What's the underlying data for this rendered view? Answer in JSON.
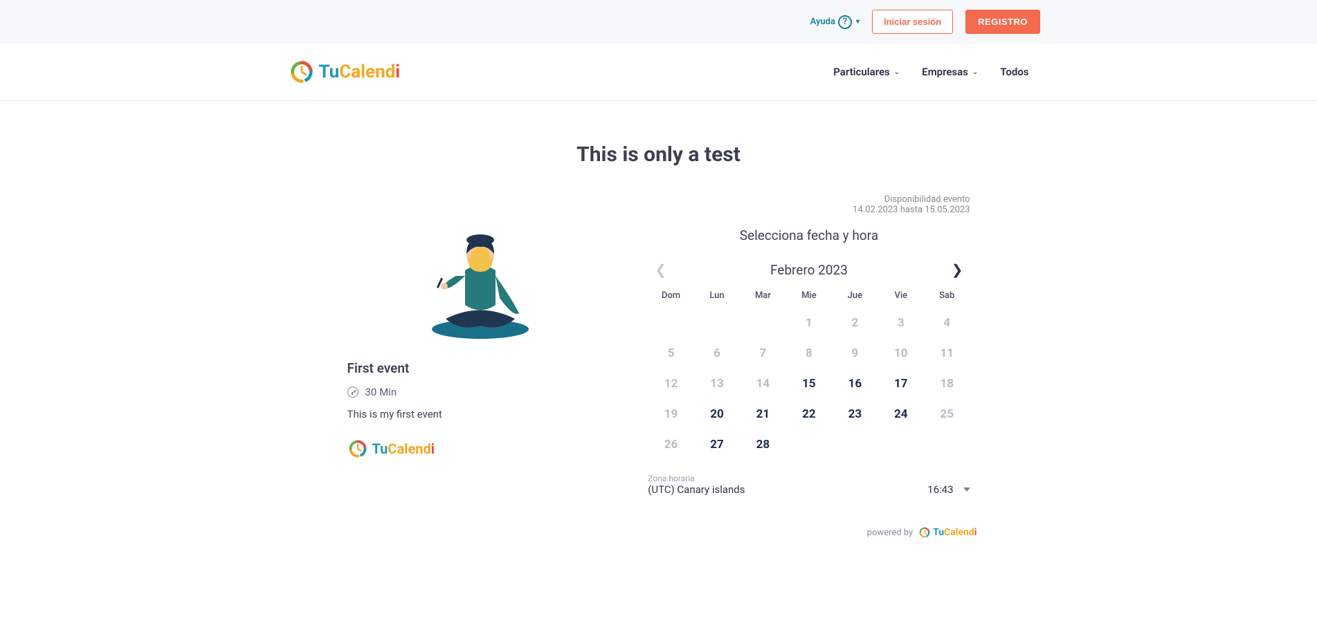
{
  "brand": {
    "name_part1": "Tu",
    "name_part2": "Calend",
    "name_part3": "i"
  },
  "utility": {
    "help_label": "Ayuda",
    "login_label": "Iniciar sesión",
    "register_label": "REGISTRO"
  },
  "nav": {
    "items": [
      {
        "label": "Particulares",
        "has_submenu": true
      },
      {
        "label": "Empresas",
        "has_submenu": true
      },
      {
        "label": "Todos",
        "has_submenu": false
      }
    ]
  },
  "page": {
    "title": "This is only a test"
  },
  "event": {
    "title": "First event",
    "duration": "30 Min",
    "description": "This is my first event"
  },
  "booking": {
    "availability_label": "Disponibilidad evento",
    "availability_range": "14.02.2023 hasta 15.05.2023",
    "heading": "Selecciona fecha y hora"
  },
  "calendar": {
    "month_label": "Febrero 2023",
    "prev_enabled": false,
    "next_enabled": true,
    "weekdays": [
      "Dom",
      "Lun",
      "Mar",
      "Mie",
      "Jue",
      "Vie",
      "Sab"
    ],
    "leading_blanks": 3,
    "days": [
      {
        "n": 1,
        "state": "disabled"
      },
      {
        "n": 2,
        "state": "disabled"
      },
      {
        "n": 3,
        "state": "disabled"
      },
      {
        "n": 4,
        "state": "disabled"
      },
      {
        "n": 5,
        "state": "disabled"
      },
      {
        "n": 6,
        "state": "disabled"
      },
      {
        "n": 7,
        "state": "disabled"
      },
      {
        "n": 8,
        "state": "disabled"
      },
      {
        "n": 9,
        "state": "disabled"
      },
      {
        "n": 10,
        "state": "disabled"
      },
      {
        "n": 11,
        "state": "disabled"
      },
      {
        "n": 12,
        "state": "disabled"
      },
      {
        "n": 13,
        "state": "disabled"
      },
      {
        "n": 14,
        "state": "disabled"
      },
      {
        "n": 15,
        "state": "available"
      },
      {
        "n": 16,
        "state": "available"
      },
      {
        "n": 17,
        "state": "available"
      },
      {
        "n": 18,
        "state": "disabled"
      },
      {
        "n": 19,
        "state": "disabled"
      },
      {
        "n": 20,
        "state": "available"
      },
      {
        "n": 21,
        "state": "available"
      },
      {
        "n": 22,
        "state": "available"
      },
      {
        "n": 23,
        "state": "available"
      },
      {
        "n": 24,
        "state": "available"
      },
      {
        "n": 25,
        "state": "disabled"
      },
      {
        "n": 26,
        "state": "disabled"
      },
      {
        "n": 27,
        "state": "available"
      },
      {
        "n": 28,
        "state": "available"
      }
    ]
  },
  "timezone": {
    "label": "Zona horaria",
    "value": "(UTC) Canary islands",
    "time": "16:43"
  },
  "footer": {
    "powered_by_label": "powered by"
  }
}
